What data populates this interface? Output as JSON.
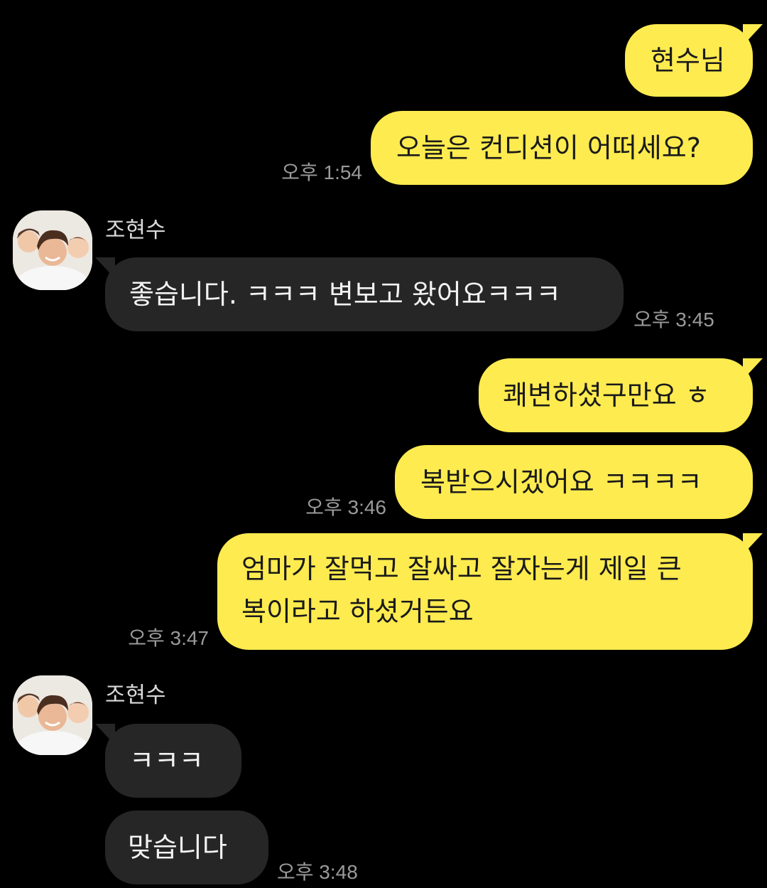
{
  "messages": [
    {
      "text": "현수님"
    },
    {
      "text": "오늘은 컨디션이 어떠세요?",
      "time": "오후 1:54"
    },
    {
      "text": "좋습니다. ㅋㅋㅋ 변보고 왔어요ㅋㅋㅋ",
      "time": "오후 3:45"
    },
    {
      "text": "쾌변하셨구만요 ㅎ"
    },
    {
      "text": "복받으시겠어요 ㅋㅋㅋㅋ",
      "time": "오후 3:46"
    },
    {
      "line1": "엄마가 잘먹고 잘싸고 잘자는게 제일 큰",
      "line2": "복이라고 하셨거든요",
      "time": "오후 3:47"
    },
    {
      "text": "ㅋㅋㅋ"
    },
    {
      "text": "맞습니다",
      "time": "오후 3:48"
    }
  ],
  "other_user": {
    "name": "조현수",
    "avatar_icon": "profile-photo-icon"
  },
  "colors": {
    "background": "#000000",
    "my_bubble": "#FEEB4F",
    "other_bubble": "#262626",
    "timestamp": "#9a9a9a"
  }
}
